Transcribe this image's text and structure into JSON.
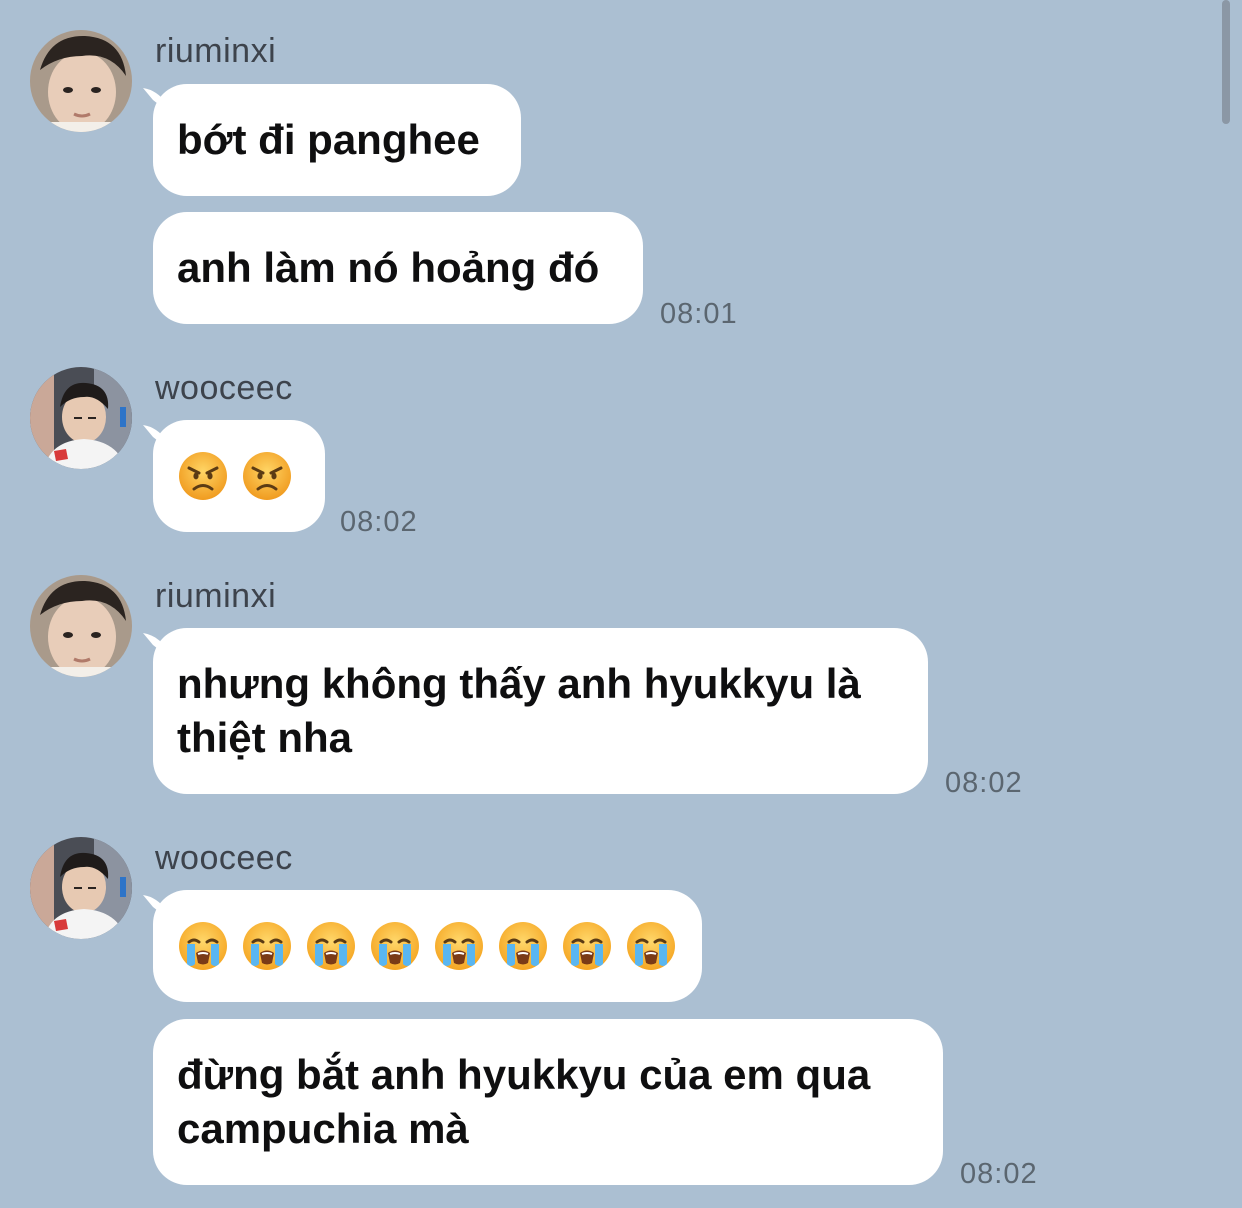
{
  "colors": {
    "background": "#abbfd2",
    "bubble": "#ffffff",
    "sender_text": "#3d434c",
    "time_text": "#5b6670"
  },
  "groups": [
    {
      "sender": "riuminxi",
      "avatar": "avatar-riuminxi",
      "messages": [
        {
          "text": "bớt đi panghee"
        },
        {
          "text": "anh làm nó hoảng đó",
          "time": "08:01"
        }
      ]
    },
    {
      "sender": "wooceec",
      "avatar": "avatar-wooceec",
      "messages": [
        {
          "emoji": "angry-face",
          "emoji_count": 2,
          "time": "08:02"
        }
      ]
    },
    {
      "sender": "riuminxi",
      "avatar": "avatar-riuminxi",
      "messages": [
        {
          "text": "nhưng không thấy anh hyukkyu là\nthiệt nha",
          "time": "08:02"
        }
      ]
    },
    {
      "sender": "wooceec",
      "avatar": "avatar-wooceec",
      "messages": [
        {
          "emoji": "loudly-crying-face",
          "emoji_count": 8
        },
        {
          "text": "đừng bắt anh hyukkyu của em qua\ncampuchia mà",
          "time": "08:02"
        }
      ]
    }
  ]
}
